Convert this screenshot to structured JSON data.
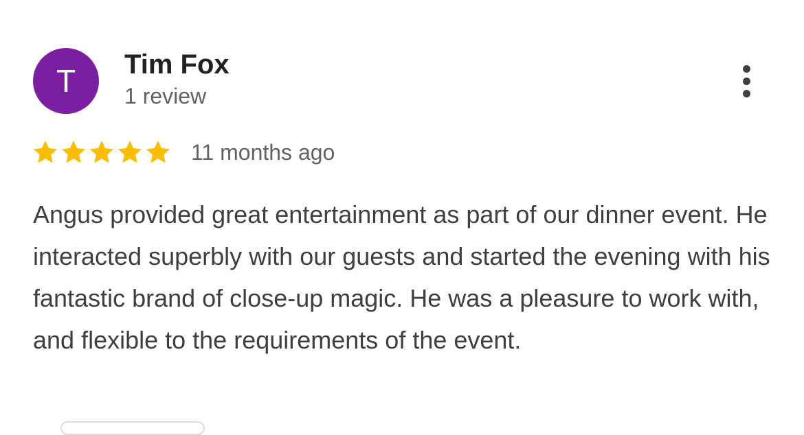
{
  "reviewer": {
    "avatar_letter": "T",
    "avatar_color": "#7b1fa2",
    "name": "Tim Fox",
    "review_count": "1 review"
  },
  "rating": {
    "stars": 5,
    "max_stars": 5,
    "star_color": "#fbbc04",
    "date": "11 months ago"
  },
  "review": {
    "text": "Angus provided great entertainment as part of our dinner event. He interacted superbly with our guests and started the evening with his fantastic brand of close-up magic. He was a pleasure to work with, and flexible to the requirements of the event."
  },
  "icons": {
    "more_menu": "more-vert-icon",
    "star": "star-icon"
  }
}
